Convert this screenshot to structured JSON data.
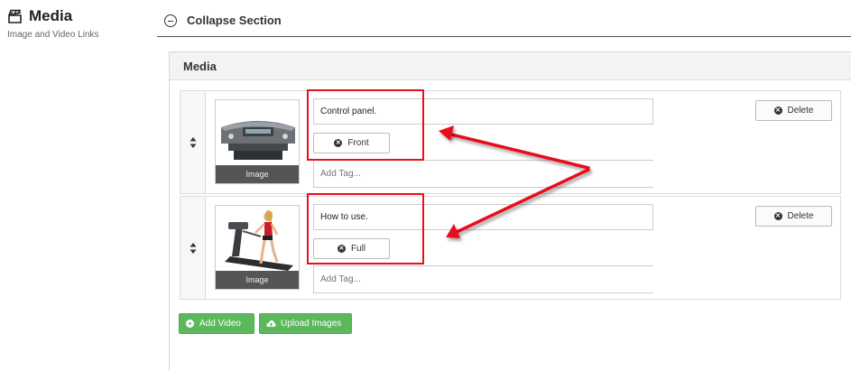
{
  "sidebar": {
    "title": "Media",
    "subtitle": "Image and Video Links",
    "icon": "media-icon"
  },
  "collapse": {
    "label": "Collapse Section"
  },
  "panel": {
    "title": "Media"
  },
  "items": [
    {
      "caption": "Control panel.",
      "tag_label": "Front",
      "tag_placeholder": "Add Tag...",
      "thumb_label": "Image",
      "delete_label": "Delete"
    },
    {
      "caption": "How to use.",
      "tag_label": "Full",
      "tag_placeholder": "Add Tag...",
      "thumb_label": "Image",
      "delete_label": "Delete"
    }
  ],
  "actions": {
    "add_video": "Add Video",
    "upload_images": "Upload Images"
  },
  "colors": {
    "highlight": "#e8101b",
    "success": "#5cb85c"
  }
}
